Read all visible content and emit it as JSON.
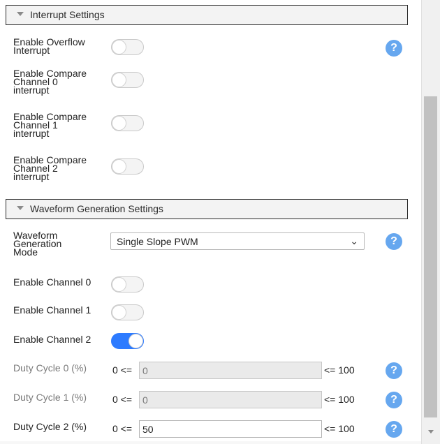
{
  "interrupt_section": {
    "title": "Interrupt Settings",
    "items": [
      {
        "label": "Enable Overflow\nInterrupt",
        "enabled": false
      },
      {
        "label": "Enable Compare\nChannel 0\ninterrupt",
        "enabled": false
      },
      {
        "label": "Enable Compare\nChannel 1\ninterrupt",
        "enabled": false
      },
      {
        "label": "Enable Compare\nChannel 2\ninterrupt",
        "enabled": false
      }
    ]
  },
  "waveform_section": {
    "title": "Waveform Generation Settings",
    "mode": {
      "label": "Waveform\nGeneration\nMode",
      "value": "Single Slope PWM"
    },
    "channels": [
      {
        "label": "Enable Channel 0",
        "enabled": false
      },
      {
        "label": "Enable Channel 1",
        "enabled": false
      },
      {
        "label": "Enable Channel 2",
        "enabled": true
      }
    ],
    "duty_cycles": [
      {
        "label": "Duty Cycle 0 (%)",
        "min_text": "0 <=",
        "value": "0",
        "max_text": "<= 100",
        "disabled": true
      },
      {
        "label": "Duty Cycle 1 (%)",
        "min_text": "0 <=",
        "value": "0",
        "max_text": "<= 100",
        "disabled": true
      },
      {
        "label": "Duty Cycle 2 (%)",
        "min_text": "0 <=",
        "value": "50",
        "max_text": "<= 100",
        "disabled": false
      }
    ]
  },
  "help_icon_text": "?",
  "colors": {
    "toggle_on": "#2d7bff",
    "help": "#66a7ef"
  }
}
